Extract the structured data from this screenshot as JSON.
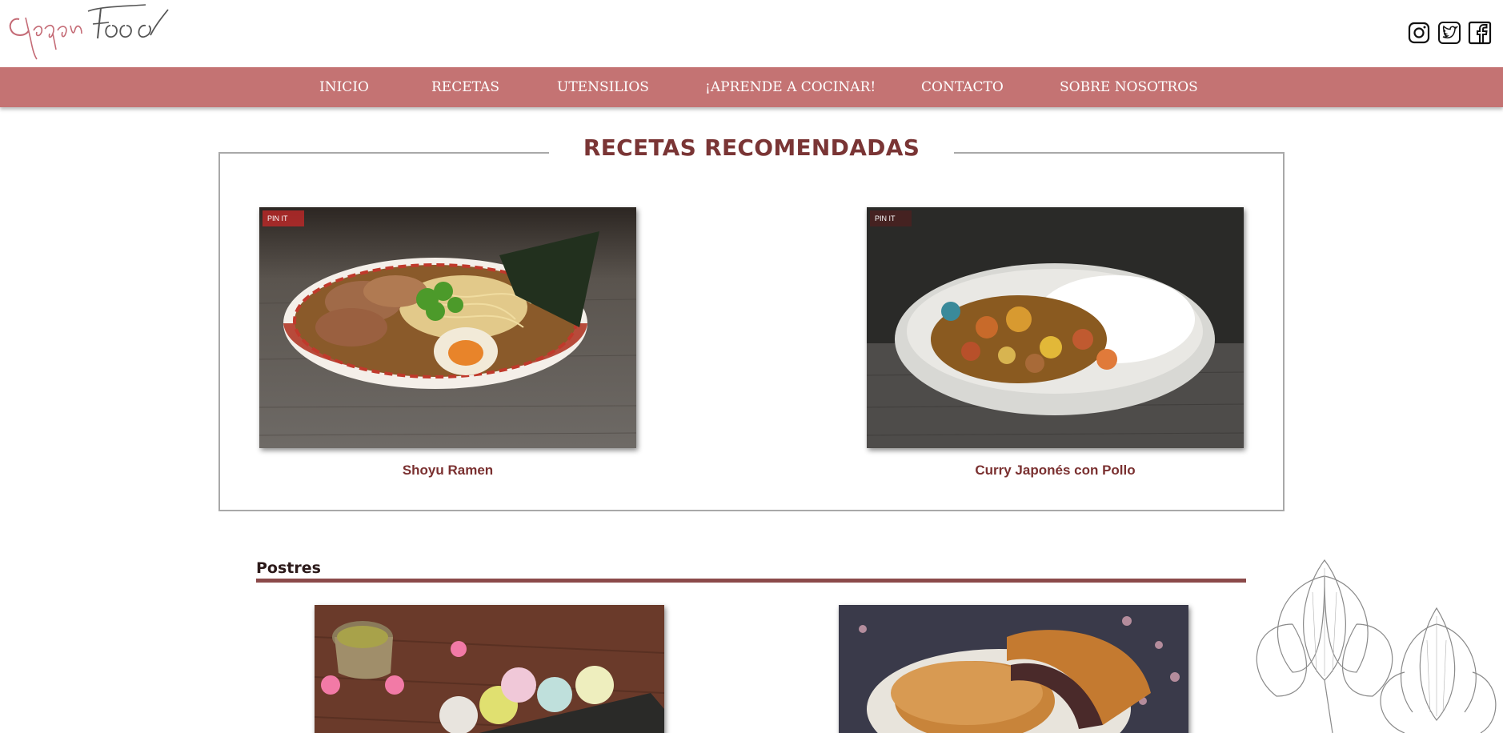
{
  "header": {
    "logo_text": "JapanFood",
    "social": [
      {
        "name": "instagram",
        "icon": "instagram-icon"
      },
      {
        "name": "twitter",
        "icon": "twitter-icon"
      },
      {
        "name": "facebook",
        "icon": "facebook-icon"
      }
    ]
  },
  "nav": {
    "items": [
      "INICIO",
      "RECETAS",
      "UTENSILIOS",
      "¡APRENDE A COCINAR!",
      "CONTACTO",
      "SOBRE NOSOTROS"
    ]
  },
  "recommended": {
    "title": "RECETAS RECOMENDADAS",
    "recipes": [
      {
        "name": "Shoyu Ramen",
        "pin": "PIN IT"
      },
      {
        "name": "Curry Japonés con Pollo",
        "pin": "PIN IT"
      }
    ]
  },
  "postres": {
    "title": "Postres"
  },
  "colors": {
    "nav_bg": "#c47373",
    "title_color": "#7a3535",
    "caption_color": "#7a3030",
    "divider": "#8b4a4a"
  }
}
